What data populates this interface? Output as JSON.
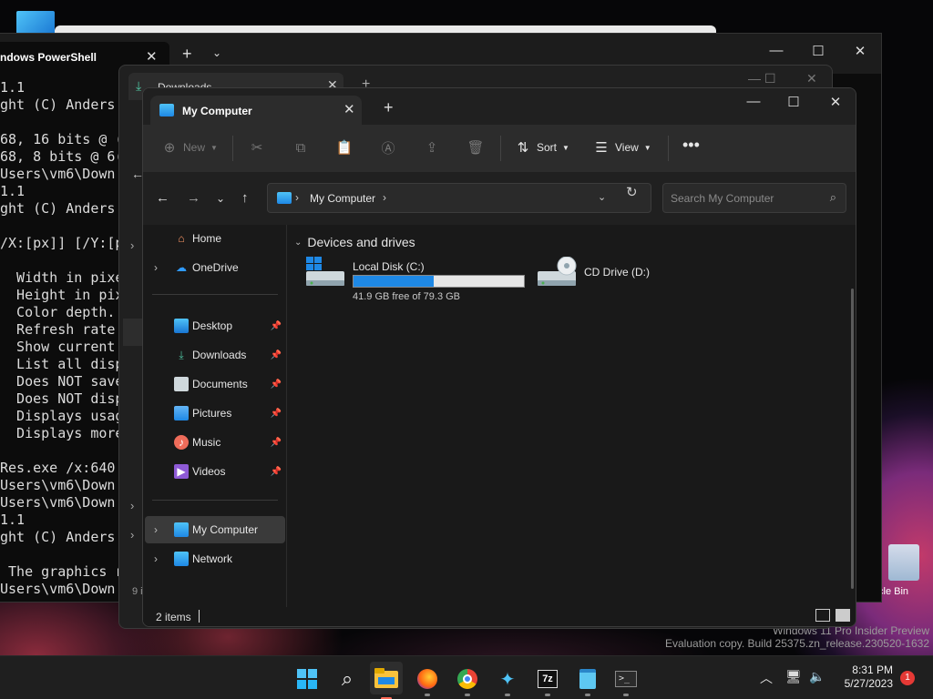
{
  "desktop": {
    "recycle_bin_label": "cle Bin",
    "watermark_line1": "Windows 11 Pro Insider Preview",
    "watermark_line2": "Evaluation copy. Build 25375.zn_release.230520-1632"
  },
  "terminal": {
    "tab_title": "ndows PowerShell",
    "lines": [
      "1.1",
      "ght (C) Anders",
      "",
      "68, 16 bits @ (",
      "68, 8 bits @ 6(",
      "Users\\vm6\\Down",
      "1.1",
      "ght (C) Anders",
      "",
      "/X:[px]] [/Y:[p",
      "",
      "  Width in pixe",
      "  Height in pix",
      "  Color depth.",
      "  Refresh rate",
      "  Show current",
      "  List all disp",
      "  Does NOT save",
      "  Does NOT disp",
      "  Displays usag",
      "  Displays more",
      "",
      "Res.exe /x:640",
      "Users\\vm6\\Down",
      "Users\\vm6\\Down",
      "1.1",
      "ght (C) Anders",
      "",
      " The graphics r",
      "Users\\vm6\\Down"
    ]
  },
  "downloads_window": {
    "tab_title": "Downloads",
    "item_count": "9 i"
  },
  "explorer": {
    "tab_title": "My Computer",
    "toolbar": {
      "new_label": "New",
      "sort_label": "Sort",
      "view_label": "View"
    },
    "address": {
      "path_label": "My Computer",
      "search_placeholder": "Search My Computer"
    },
    "nav": {
      "home": "Home",
      "onedrive": "OneDrive",
      "desktop": "Desktop",
      "downloads": "Downloads",
      "documents": "Documents",
      "pictures": "Pictures",
      "music": "Music",
      "videos": "Videos",
      "my_computer": "My Computer",
      "network": "Network"
    },
    "content": {
      "group_title": "Devices and drives",
      "drives": [
        {
          "name": "Local Disk (C:)",
          "free_text": "41.9 GB free of 79.3 GB",
          "used_fraction": 0.47
        },
        {
          "name": "CD Drive (D:)"
        }
      ]
    },
    "status": {
      "item_count": "2 items"
    }
  },
  "taskbar": {
    "apps": [
      "start-icon",
      "search-icon",
      "file-explorer-icon",
      "firefox-icon",
      "chrome-icon",
      "app-icon",
      "7zip-icon",
      "notepad-icon",
      "terminal-icon"
    ],
    "seven_zip_label": "7z",
    "time": "8:31 PM",
    "date": "5/27/2023",
    "notification_count": "1"
  },
  "colors": {
    "accent": "#1e88e5",
    "notification": "#e53935",
    "active_indicator": "#ff6b57"
  }
}
